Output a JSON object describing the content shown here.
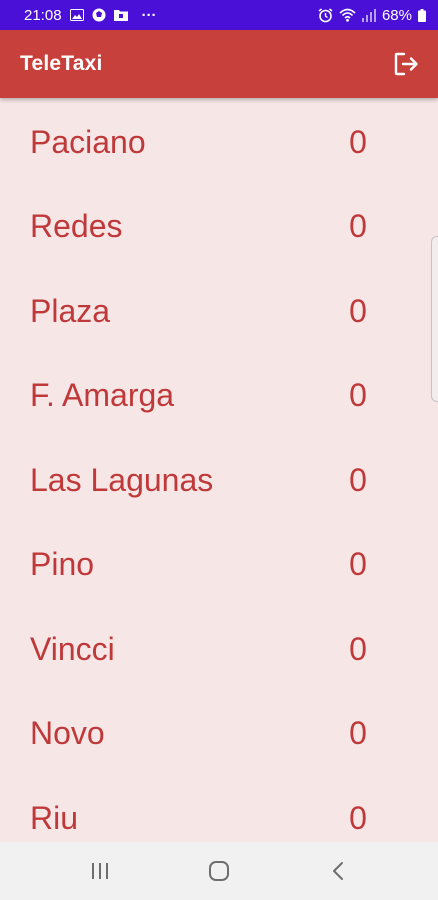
{
  "status_bar": {
    "time": "21:08",
    "more_indicator": "···",
    "battery_percent": "68%",
    "background_color": "#4a10d8"
  },
  "app_bar": {
    "title": "TeleTaxi",
    "background_color": "#c7403b",
    "logout_icon": "logout-icon"
  },
  "stops": [
    {
      "name": "Paciano",
      "count": "0"
    },
    {
      "name": "Redes",
      "count": "0"
    },
    {
      "name": "Plaza",
      "count": "0"
    },
    {
      "name": "F. Amarga",
      "count": "0"
    },
    {
      "name": "Las Lagunas",
      "count": "0"
    },
    {
      "name": "Pino",
      "count": "0"
    },
    {
      "name": "Vincci",
      "count": "0"
    },
    {
      "name": "Novo",
      "count": "0"
    },
    {
      "name": "Riu",
      "count": "0"
    }
  ],
  "colors": {
    "list_background": "#f6e6e6",
    "list_text": "#c0393a"
  },
  "nav_bar": {
    "icons": [
      "recent-apps-icon",
      "home-icon",
      "back-icon"
    ]
  }
}
